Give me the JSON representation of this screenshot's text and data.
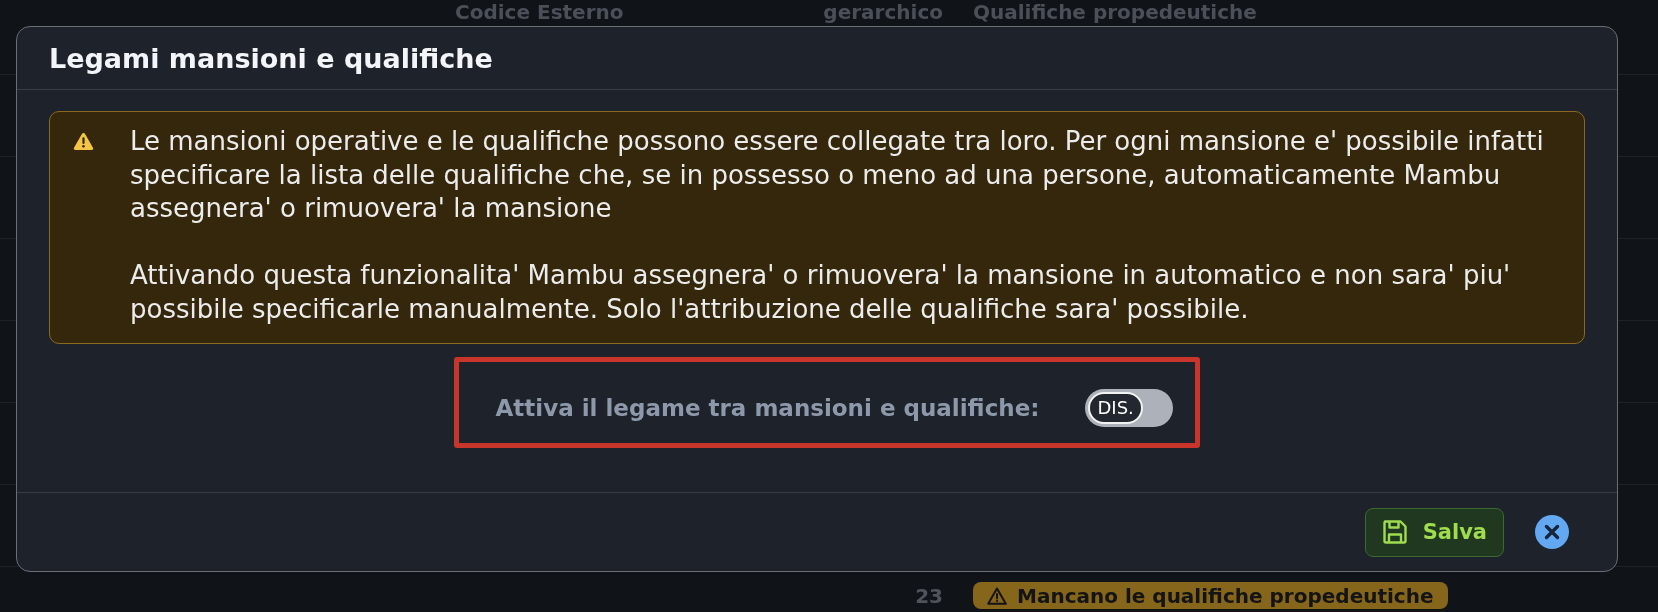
{
  "background_table": {
    "columns": [
      "Codice Esterno",
      "gerarchico",
      "Qualifiche propedeutiche"
    ],
    "row": {
      "number": "23",
      "badge": "Mancano le qualifiche propedeutiche"
    }
  },
  "dialog": {
    "title": "Legami mansioni e qualifiche",
    "warning": {
      "paragraphs": [
        "Le mansioni operative e le qualifiche possono essere collegate tra loro. Per ogni mansione e' possibile infatti specificare la lista delle qualifiche che, se in possesso o meno ad una persone, automaticamente Mambu assegnera' o rimuovera' la mansione",
        "Attivando questa funzionalita' Mambu assegnera' o rimuovera' la mansione in automatico e non sara' piu' possibile specificarle manualmente. Solo l'attribuzione delle qualifiche sara' possibile."
      ]
    },
    "setting": {
      "label": "Attiva il legame tra mansioni e qualifiche:",
      "on": false,
      "state_text": "DIS."
    },
    "buttons": [
      {
        "kind": "save",
        "label": "Salva"
      },
      {
        "kind": "close"
      }
    ]
  }
}
